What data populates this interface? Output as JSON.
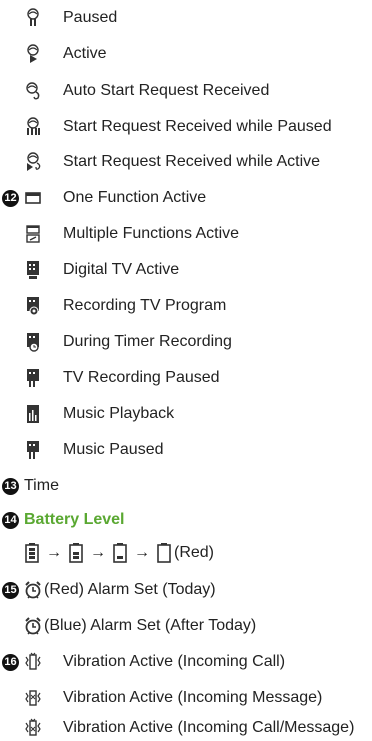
{
  "items": [
    {
      "icon": "remote-paused-icon",
      "label": "Paused"
    },
    {
      "icon": "remote-active-icon",
      "label": "Active"
    },
    {
      "icon": "auto-start-request-icon",
      "label": "Auto Start Request Received"
    },
    {
      "icon": "start-request-paused-icon",
      "label": "Start Request Received while Paused"
    },
    {
      "icon": "start-request-active-icon",
      "label": "Start Request Received while Active"
    },
    {
      "number": "12",
      "icon": "one-function-icon",
      "label": "One Function Active"
    },
    {
      "icon": "multiple-functions-icon",
      "label": "Multiple Functions Active"
    },
    {
      "icon": "digital-tv-icon",
      "label": "Digital TV Active"
    },
    {
      "icon": "recording-tv-icon",
      "label": "Recording TV Program"
    },
    {
      "icon": "timer-recording-icon",
      "label": "During Timer Recording"
    },
    {
      "icon": "tv-recording-paused-icon",
      "label": "TV Recording Paused"
    },
    {
      "icon": "music-playback-icon",
      "label": "Music Playback"
    },
    {
      "icon": "music-paused-icon",
      "label": "Music Paused"
    }
  ],
  "time": {
    "number": "13",
    "label": "Time"
  },
  "battery": {
    "number": "14",
    "label": "Battery Level",
    "color": "#5aa832",
    "sequence_suffix": "(Red)",
    "arrow": "→"
  },
  "alarm": [
    {
      "number": "15",
      "icon": "alarm-red-icon",
      "label": "(Red)  Alarm Set (Today)",
      "color": "#cc2222"
    },
    {
      "icon": "alarm-blue-icon",
      "label": "(Blue) Alarm Set (After Today)",
      "color": "#2255cc"
    }
  ],
  "vibration": [
    {
      "number": "16",
      "icon": "vibration-call-icon",
      "label": "Vibration Active (Incoming Call)"
    },
    {
      "icon": "vibration-message-icon",
      "label": "Vibration Active (Incoming Message)"
    },
    {
      "icon": "vibration-call-message-icon",
      "label": "Vibration Active (Incoming Call/Message)"
    }
  ]
}
